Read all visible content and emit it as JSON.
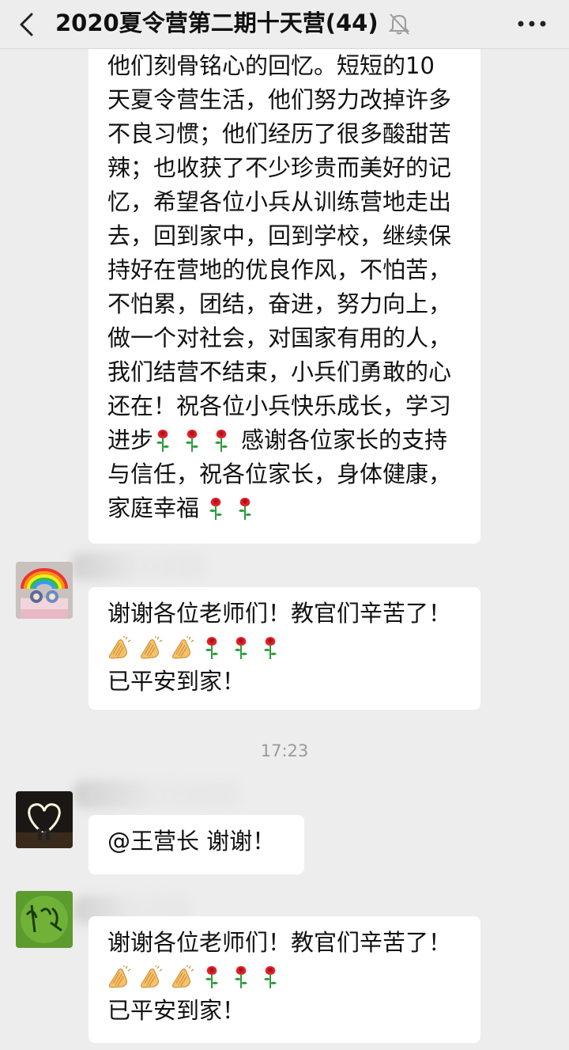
{
  "header": {
    "title": "2020夏令营第二期十天营(44)",
    "back_icon": "chevron-left-icon",
    "mute_icon": "bell-off-icon",
    "more_icon": "ellipsis-icon"
  },
  "messages": [
    {
      "lines": [
        "他们刻骨铭心的回忆。短短的10",
        "天夏令营生活，他们努力改掉许多",
        "不良习惯；他们经历了很多酸甜苦",
        "辣；也收获了不少珍贵而美好的记",
        "忆，希望各位小兵从训练营地走出",
        "去，回到家中，回到学校，继续保",
        "持好在营地的优良作风，不怕苦，",
        "不怕累，团结，奋进，努力向上，",
        "做一个对社会，对国家有用的人，",
        "我们结营不结束，小兵们勇敢的心",
        "还在！祝各位小兵快乐成长，学习"
      ],
      "line12_prefix": "进步",
      "line12_suffix": "感谢各位家长的支持",
      "line13": "与信任，祝各位家长，身体健康，",
      "line14": "家庭幸福"
    },
    {
      "line1": "谢谢各位老师们！教官们辛苦了！",
      "line3": "已平安到家！"
    },
    {
      "line1": "@王营长  谢谢！"
    },
    {
      "line1": "谢谢各位老师们！教官们辛苦了！",
      "line3": "已平安到家！"
    }
  ],
  "timestamp": "17:23",
  "emoji": {
    "rose": "rose-emoji",
    "clap": "clap-emoji"
  },
  "colors": {
    "background": "#ededed",
    "bubble": "#ffffff",
    "rose_red": "#e0202a",
    "rose_stem": "#2e9a3a",
    "clap_skin": "#f5c16c"
  }
}
